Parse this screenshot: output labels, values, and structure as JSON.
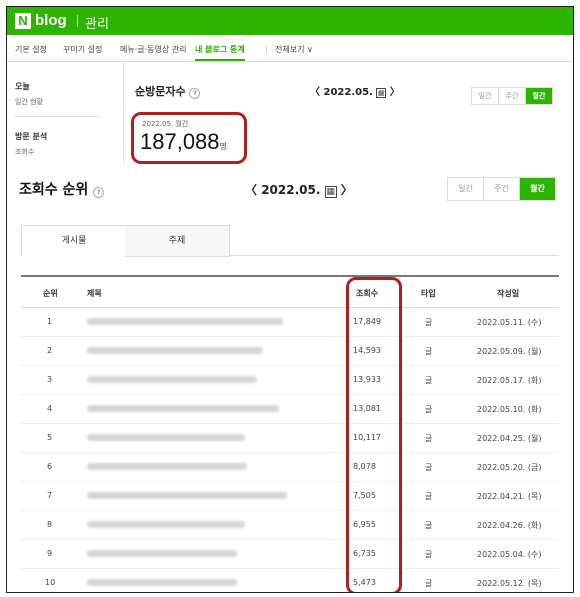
{
  "header": {
    "logo_letter": "N",
    "logo_word": "blog",
    "section": "관리"
  },
  "tabs": [
    {
      "label": "기본 설정"
    },
    {
      "label": "꾸미기 설정"
    },
    {
      "label": "메뉴·글·동영상 관리"
    },
    {
      "label": "내 블로그 통계",
      "active": true
    },
    {
      "label": "전체보기 ∨"
    }
  ],
  "left_nav": {
    "group1_title": "오늘",
    "group1_item": "일간 현황",
    "group2_title": "방문 분석",
    "group2_item": "조회수"
  },
  "visitors": {
    "title": "순방문자수",
    "help": "?",
    "date": "2022.05.",
    "prev": "〈",
    "next": "〉",
    "cal": "▦",
    "periods": [
      "일간",
      "주간",
      "월간"
    ],
    "active_period": "월간",
    "stat_label": "2022.05. 월간",
    "stat_value": "187,088",
    "stat_unit": "명"
  },
  "ranking": {
    "title": "조회수 순위",
    "help": "?",
    "date": "2022.05.",
    "prev": "〈",
    "next": "〉",
    "cal": "▦",
    "periods": [
      "일간",
      "주간",
      "월간"
    ],
    "active_period": "월간",
    "subtabs": [
      "게시물",
      "주제"
    ],
    "active_subtab": "게시물",
    "columns": {
      "rank": "순위",
      "title": "제목",
      "views": "조회수",
      "type": "타입",
      "date": "작성일"
    },
    "rows": [
      {
        "rank": "1",
        "views": "17,849",
        "type": "글",
        "date": "2022.05.11. (수)"
      },
      {
        "rank": "2",
        "views": "14,593",
        "type": "글",
        "date": "2022.05.09. (월)"
      },
      {
        "rank": "3",
        "views": "13,933",
        "type": "글",
        "date": "2022.05.17. (화)"
      },
      {
        "rank": "4",
        "views": "13,081",
        "type": "글",
        "date": "2022.05.10. (화)"
      },
      {
        "rank": "5",
        "views": "10,117",
        "type": "글",
        "date": "2022.04.25. (월)"
      },
      {
        "rank": "6",
        "views": "8,078",
        "type": "글",
        "date": "2022.05.20. (금)"
      },
      {
        "rank": "7",
        "views": "7,505",
        "type": "글",
        "date": "2022.04.21. (목)"
      },
      {
        "rank": "8",
        "views": "6,955",
        "type": "글",
        "date": "2022.04.26. (화)"
      },
      {
        "rank": "9",
        "views": "6,735",
        "type": "글",
        "date": "2022.05.04. (수)"
      },
      {
        "rank": "10",
        "views": "5,473",
        "type": "글",
        "date": "2022.05.12. (목)"
      }
    ]
  },
  "colors": {
    "brand_green": "#2db400",
    "highlight_red": "#b01f1f"
  }
}
